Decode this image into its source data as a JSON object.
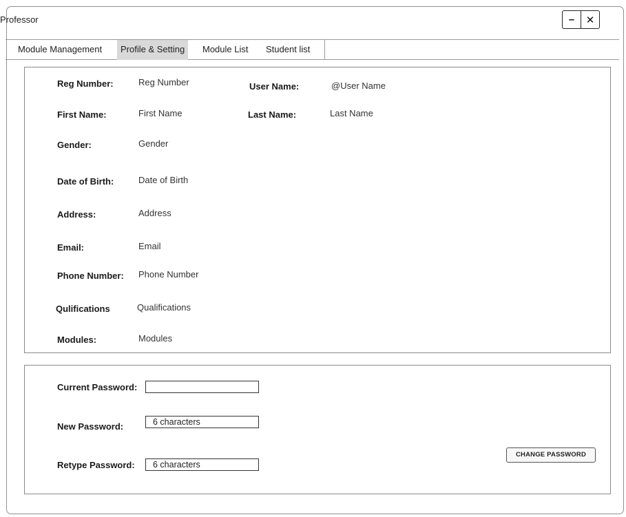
{
  "window": {
    "title": "Professor",
    "minimize_glyph": "–",
    "close_glyph": "✕"
  },
  "tabs": [
    {
      "label": "Module Management",
      "active": false
    },
    {
      "label": "Profile & Setting",
      "active": true
    },
    {
      "label": "Module List",
      "active": false
    },
    {
      "label": "Student list",
      "active": false
    }
  ],
  "profile": {
    "reg_number": {
      "label": "Reg Number:",
      "value": "Reg Number"
    },
    "user_name": {
      "label": "User Name:",
      "value": "@User Name"
    },
    "first_name": {
      "label": "First Name:",
      "value": "First Name"
    },
    "last_name": {
      "label": "Last Name:",
      "value": "Last Name"
    },
    "gender": {
      "label": "Gender:",
      "value": "Gender"
    },
    "dob": {
      "label": "Date of Birth:",
      "value": "Date of Birth"
    },
    "address": {
      "label": "Address:",
      "value": "Address"
    },
    "email": {
      "label": "Email:",
      "value": "Email"
    },
    "phone": {
      "label": "Phone Number:",
      "value": "Phone Number"
    },
    "qualifications": {
      "label": "Qulifications",
      "value": "Qualifications"
    },
    "modules": {
      "label": "Modules:",
      "value": "Modules"
    }
  },
  "password": {
    "current": {
      "label": "Current Password:",
      "value": ""
    },
    "new": {
      "label": "New Password:",
      "value": "6 characters"
    },
    "retype": {
      "label": "Retype Password:",
      "value": "6 characters"
    },
    "change_button": "CHANGE PASSWORD"
  }
}
